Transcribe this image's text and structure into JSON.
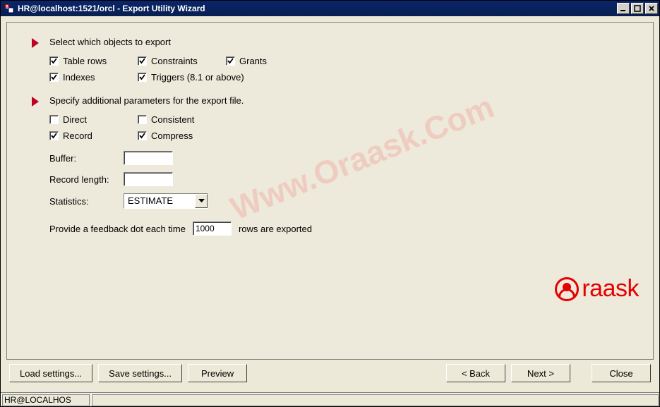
{
  "window": {
    "title": "HR@localhost:1521/orcl - Export Utility Wizard"
  },
  "section1": {
    "title": "Select which objects to export",
    "checks": {
      "table_rows": "Table rows",
      "constraints": "Constraints",
      "grants": "Grants",
      "indexes": "Indexes",
      "triggers": "Triggers (8.1 or above)"
    }
  },
  "section2": {
    "title": "Specify additional parameters for the export file.",
    "checks": {
      "direct": "Direct",
      "consistent": "Consistent",
      "record": "Record",
      "compress": "Compress"
    },
    "buffer_label": "Buffer:",
    "buffer_value": "",
    "reclen_label": "Record length:",
    "reclen_value": "",
    "stats_label": "Statistics:",
    "stats_value": "ESTIMATE",
    "feedback_prefix": "Provide a feedback dot each time",
    "feedback_value": "1000",
    "feedback_suffix": "rows are exported"
  },
  "buttons": {
    "load": "Load settings...",
    "save": "Save settings...",
    "preview": "Preview",
    "back": "< Back",
    "next": "Next >",
    "close": "Close"
  },
  "statusbar": {
    "pane1": "HR@LOCALHOS"
  },
  "watermark": {
    "diag": "Www.Oraask.Com",
    "brand": "raask"
  }
}
